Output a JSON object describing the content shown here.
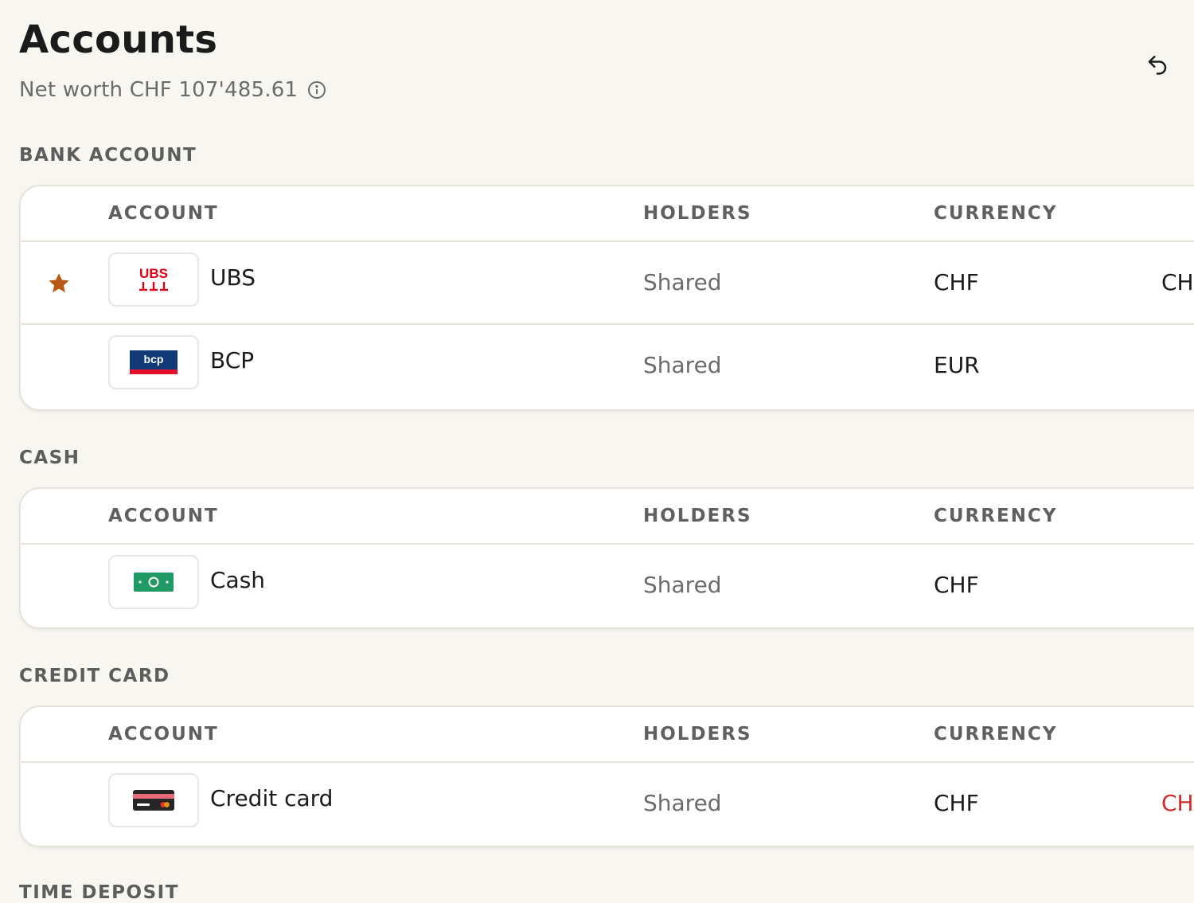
{
  "header": {
    "title": "Accounts",
    "net_worth": "Net worth CHF 107'485.61"
  },
  "columns": {
    "account": "ACCOUNT",
    "holders": "HOLDERS",
    "currency": "CURRENCY"
  },
  "sections": [
    {
      "title": "BANK ACCOUNT",
      "rows": [
        {
          "name": "UBS",
          "logo_text": "UBS",
          "holders": "Shared",
          "currency": "CHF",
          "balance": "CH",
          "starred": true
        },
        {
          "name": "BCP",
          "logo_text": "bcp",
          "holders": "Shared",
          "currency": "EUR",
          "balance": "",
          "starred": false
        }
      ]
    },
    {
      "title": "CASH",
      "rows": [
        {
          "name": "Cash",
          "holders": "Shared",
          "currency": "CHF",
          "balance": ""
        }
      ]
    },
    {
      "title": "CREDIT CARD",
      "rows": [
        {
          "name": "Credit card",
          "holders": "Shared",
          "currency": "CHF",
          "balance": "CH"
        }
      ]
    },
    {
      "title": "TIME DEPOSIT"
    }
  ],
  "colors": {
    "background": "#f8f6f1",
    "star": "#b65a16",
    "negative": "#d12b2b",
    "ubs_red": "#e00015",
    "bcp_blue": "#0f3a75",
    "cash_green": "#1f9a62"
  },
  "icons": {
    "undo": "undo-icon",
    "info": "info-icon",
    "star": "star-icon"
  }
}
